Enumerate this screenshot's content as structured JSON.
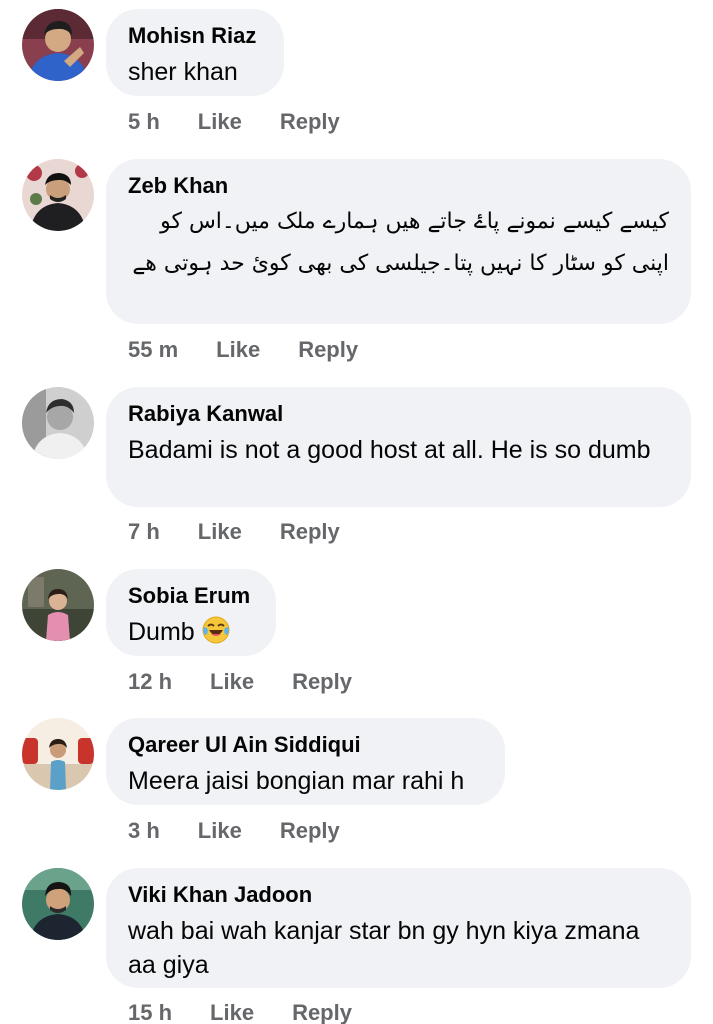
{
  "comments": [
    {
      "author": "Mohisn Riaz",
      "text": "sher khan",
      "time": "5 h",
      "like": "Like",
      "reply": "Reply",
      "avatar_colors": [
        "#3b6fd1",
        "#2a2a2a",
        "#c9a27a"
      ]
    },
    {
      "author": "Zeb Khan",
      "text": "کیسے کیسے نمونے پاۓ جاتے ھیں ہمارے ملک میں۔اس کو اپنی کو سٹار کا نہیں پتا۔جیلسی کی بھی کوئ حد ہوتی ھے",
      "time": "55 m",
      "like": "Like",
      "reply": "Reply",
      "avatar_colors": [
        "#7a4a3a",
        "#1c1c1c",
        "#d9b38c"
      ]
    },
    {
      "author": "Rabiya Kanwal",
      "text": "Badami is not a good host at all. He is so dumb",
      "time": "7 h",
      "like": "Like",
      "reply": "Reply",
      "avatar_colors": [
        "#9a9a9a",
        "#3a3a3a",
        "#bdbdbd"
      ]
    },
    {
      "author": "Sobia Erum",
      "text": "Dumb",
      "emoji": "laughing-crying-emoji",
      "time": "12 h",
      "like": "Like",
      "reply": "Reply",
      "avatar_colors": [
        "#6b6e5a",
        "#e58fb0",
        "#3f4a3a"
      ]
    },
    {
      "author": "Qareer Ul Ain Siddiqui",
      "text": "Meera jaisi bongian mar rahi h",
      "time": "3 h",
      "like": "Like",
      "reply": "Reply",
      "avatar_colors": [
        "#f3e9d8",
        "#c8342b",
        "#5aa0c8"
      ]
    },
    {
      "author": "Viki Khan Jadoon",
      "text": "wah bai wah kanjar star bn gy hyn kiya zmana aa giya",
      "time": "15 h",
      "like": "Like",
      "reply": "Reply",
      "avatar_colors": [
        "#2f6e5a",
        "#1a1a1a",
        "#c9a07a"
      ]
    }
  ],
  "colors": {
    "bubble_bg": "#f0f2f5",
    "meta_text": "#65676b",
    "main_text": "#050505"
  }
}
